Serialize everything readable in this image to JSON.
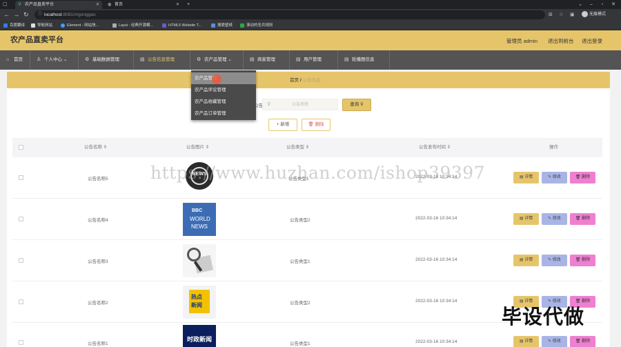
{
  "browser": {
    "tabs": [
      {
        "title": "农产品直卖平台",
        "favicon": "V",
        "active": true
      },
      {
        "title": "首页",
        "favicon": "◍",
        "active": false
      }
    ],
    "url_host": "localhost",
    "url_rest": ":8081/#/gonggao",
    "profile_label": "无痕模式",
    "bookmarks": [
      "百度翻译",
      "导航网站",
      "Element - 网站快...",
      "Layui - 经典开源模...",
      "HTML5 Website T...",
      "搜索壁纸",
      "滚动的圣兵规则"
    ]
  },
  "app": {
    "title": "农产品直卖平台",
    "user_label": "管理员 admin",
    "goto_front": "退出到前台",
    "logout": "退出登录"
  },
  "nav": [
    {
      "label": "首页",
      "icon": "home-icon"
    },
    {
      "label": "个人中心",
      "icon": "user-icon",
      "arrow": true
    },
    {
      "label": "基础数据管理",
      "icon": "gear-icon"
    },
    {
      "label": "公告信息管理",
      "icon": "message-icon"
    },
    {
      "label": "农产品管理",
      "icon": "gear-icon",
      "arrow": true
    },
    {
      "label": "商家管理",
      "icon": "list-icon"
    },
    {
      "label": "用户管理",
      "icon": "list-icon"
    },
    {
      "label": "轮播图信息",
      "icon": "list-icon"
    }
  ],
  "dropdown": [
    "农产品管理",
    "农产品评论管理",
    "农产品收藏管理",
    "农产品订单管理"
  ],
  "breadcrumb": {
    "home": "首页",
    "sep": "/",
    "current": "公告信息"
  },
  "search": {
    "label": "公告名称",
    "placeholder": "公告名称",
    "button": "查询 ⚲"
  },
  "buttons": {
    "add": "+ 新增",
    "delete": "🗑 删除"
  },
  "table": {
    "headers": [
      "公告名称 ⇕",
      "公告图片 ⇕",
      "公告类型 ⇕",
      "公告发布时间 ⇕",
      "操作"
    ],
    "rows": [
      {
        "name": "公告名称5",
        "image": "news-globe",
        "type": "公告类型1",
        "time": "2022-03-16 10:34:14"
      },
      {
        "name": "公告名称4",
        "image": "bbc-world-news",
        "type": "公告类型2",
        "time": "2022-03-16 10:34:14"
      },
      {
        "name": "公告名称3",
        "image": "news-magnifier",
        "type": "公告类型1",
        "time": "2022-03-16 10:34:14"
      },
      {
        "name": "公告名称2",
        "image": "hot-news",
        "type": "公告类型2",
        "time": "2022-03-16 10:34:14"
      },
      {
        "name": "公告名称1",
        "image": "politics-news",
        "type": "公告类型1",
        "time": "2022-03-16 10:34:14"
      }
    ],
    "actions": {
      "detail": "▤ 详情",
      "edit": "✎ 修改",
      "delete": "🗑 删除"
    }
  },
  "thumb_text": {
    "bbc_line1": "BBC",
    "bbc_line2": "WORLD",
    "bbc_line3": "NEWS",
    "hot1": "热点",
    "hot2": "新闻",
    "pol": "时政新闻",
    "globe": "NEWS"
  },
  "watermarks": {
    "url": "https://www.huzhan.com/ishop39397",
    "big": "毕设代做"
  },
  "colors": {
    "accent": "#e6c56a",
    "nav_bg": "#545454",
    "edit": "#a9b4e6",
    "danger": "#ef7fd1"
  }
}
